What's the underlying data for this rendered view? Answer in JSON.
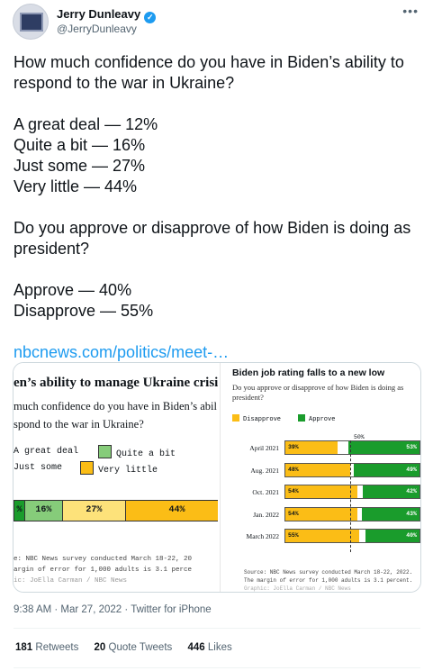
{
  "tweet": {
    "author_name": "Jerry Dunleavy",
    "author_handle": "@JerryDunleavy",
    "more_glyph": "•••",
    "verified_glyph": "✓",
    "lines": {
      "q1": "How much confidence do you have in Biden’s ability to respond to the war in Ukraine?",
      "a1": "A great deal — 12%",
      "a2": "Quite a bit — 16%",
      "a3": "Just some — 27%",
      "a4": "Very little — 44%",
      "q2": "Do you approve or disapprove of how Biden is doing as president?",
      "b1": "Approve — 40%",
      "b2": "Disapprove — 55%"
    },
    "link_text": "nbcnews.com/politics/meet-…",
    "timestamp": "9:38 AM · Mar 27, 2022 · Twitter for iPhone",
    "stats": {
      "retweets_count": "181",
      "retweets_label": "Retweets",
      "quotes_count": "20",
      "quotes_label": "Quote Tweets",
      "likes_count": "446",
      "likes_label": "Likes"
    }
  },
  "media_left": {
    "title": "en’s ability to manage Ukraine crisis",
    "question_line1": "much confidence do you have in Biden’s abil",
    "question_line2": "spond to the war in Ukraine?",
    "legend": {
      "great_deal": "A great deal",
      "quite_a_bit": "Quite a bit",
      "just_some": "Just some",
      "very_little": "Very little"
    },
    "bar_labels": {
      "seg0": "%",
      "seg1": "16%",
      "seg2": "27%",
      "seg3": "44%"
    },
    "source_line1": "e: NBC News survey conducted March 18-22, 20",
    "source_line2": "argin of error for 1,000 adults is 3.1 perce",
    "source_line3": "ic: JoElla Carman / NBC News"
  },
  "media_right": {
    "title": "Biden job rating falls to a new low",
    "question": "Do you approve or disapprove of how Biden is doing as president?",
    "legend_disapprove": "Disapprove",
    "legend_approve": "Approve",
    "fifty_label": "50%",
    "source_line1": "Source: NBC News survey conducted March 18-22, 2022.",
    "source_line2": "The margin of error for 1,000 adults is 3.1 percent.",
    "source_line3": "Graphic: JoElla Carman / NBC News"
  },
  "chart_data": [
    {
      "type": "bar",
      "title": "",
      "categories": [
        "A great deal",
        "Quite a bit",
        "Just some",
        "Very little"
      ],
      "values": [
        12,
        16,
        27,
        44
      ],
      "colors": [
        "#1a9c2c",
        "#86cc7a",
        "#fde27a",
        "#fbbd16"
      ]
    },
    {
      "type": "bar",
      "title": "Biden job rating falls to a new low",
      "categories": [
        "April 2021",
        "Aug. 2021",
        "Oct. 2021",
        "Jan. 2022",
        "March 2022"
      ],
      "series": [
        {
          "name": "Disapprove",
          "values": [
            39,
            48,
            54,
            54,
            55
          ],
          "labels": [
            "39%",
            "48%",
            "54%",
            "54%",
            "55%"
          ],
          "color": "#fbbd16"
        },
        {
          "name": "Approve",
          "values": [
            53,
            49,
            42,
            43,
            40
          ],
          "labels": [
            "53%",
            "49%",
            "42%",
            "43%",
            "40%"
          ],
          "color": "#1a9c2c"
        }
      ],
      "xlim": [
        0,
        100
      ]
    }
  ]
}
